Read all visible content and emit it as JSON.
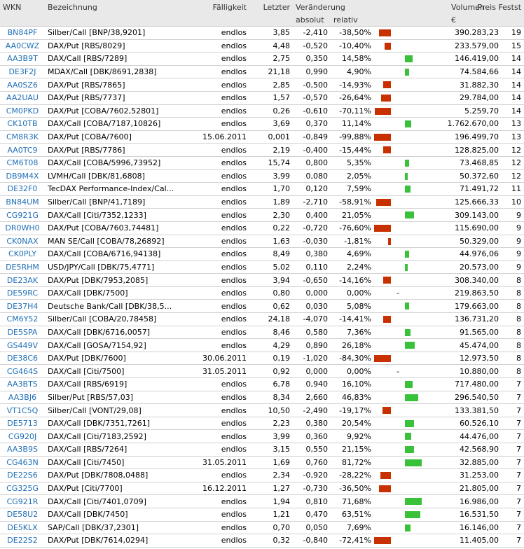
{
  "headers": {
    "wkn": "WKN",
    "bezeichnung": "Bezeichnung",
    "faelligkeit": "Fälligkeit",
    "letzter": "Letzter",
    "veraenderung": "Veränderung",
    "absolut": "absolut",
    "relativ": "relativ",
    "volumen": "Volumen",
    "waehrung": "€",
    "preis": "Preis Festst."
  },
  "colors": {
    "negative": "#c93000",
    "positive": "#39c239",
    "link": "#1f6eb6"
  },
  "rows": [
    {
      "wkn": "BN84PF",
      "name": "Silber/Call [BNP/38,9201]",
      "due": "endlos",
      "last": "3,85",
      "abs": "-2,410",
      "rel": "-38,50%",
      "relv": -38.5,
      "vol": "390.283,23",
      "fix": "19"
    },
    {
      "wkn": "AA0CWZ",
      "name": "DAX/Put [RBS/8029]",
      "due": "endlos",
      "last": "4,48",
      "abs": "-0,520",
      "rel": "-10,40%",
      "relv": -10.4,
      "vol": "233.579,00",
      "fix": "15"
    },
    {
      "wkn": "AA3B9T",
      "name": "DAX/Call [RBS/7289]",
      "due": "endlos",
      "last": "2,75",
      "abs": "0,350",
      "rel": "14,58%",
      "relv": 14.58,
      "vol": "146.419,00",
      "fix": "14"
    },
    {
      "wkn": "DE3F2J",
      "name": "MDAX/Call [DBK/8691,2838]",
      "due": "endlos",
      "last": "21,18",
      "abs": "0,990",
      "rel": "4,90%",
      "relv": 4.9,
      "vol": "74.584,66",
      "fix": "14"
    },
    {
      "wkn": "AA0SZ6",
      "name": "DAX/Put [RBS/7865]",
      "due": "endlos",
      "last": "2,85",
      "abs": "-0,500",
      "rel": "-14,93%",
      "relv": -14.93,
      "vol": "31.882,30",
      "fix": "14"
    },
    {
      "wkn": "AA2UAU",
      "name": "DAX/Put [RBS/7737]",
      "due": "endlos",
      "last": "1,57",
      "abs": "-0,570",
      "rel": "-26,64%",
      "relv": -26.64,
      "vol": "29.784,00",
      "fix": "14"
    },
    {
      "wkn": "CM0PKD",
      "name": "DAX/Put [COBA/7602,52801]",
      "due": "endlos",
      "last": "0,26",
      "abs": "-0,610",
      "rel": "-70,11%",
      "relv": -70.11,
      "vol": "5.259,70",
      "fix": "14"
    },
    {
      "wkn": "CK10TB",
      "name": "DAX/Call [COBA/7187,10826]",
      "due": "endlos",
      "last": "3,69",
      "abs": "0,370",
      "rel": "11,14%",
      "relv": 11.14,
      "vol": "1.762.670,00",
      "fix": "13"
    },
    {
      "wkn": "CM8R3K",
      "name": "DAX/Put [COBA/7600]",
      "due": "15.06.2011",
      "last": "0,001",
      "abs": "-0,849",
      "rel": "-99,88%",
      "relv": -99.88,
      "vol": "196.499,70",
      "fix": "13"
    },
    {
      "wkn": "AA0TC9",
      "name": "DAX/Put [RBS/7786]",
      "due": "endlos",
      "last": "2,19",
      "abs": "-0,400",
      "rel": "-15,44%",
      "relv": -15.44,
      "vol": "128.825,00",
      "fix": "12"
    },
    {
      "wkn": "CM6T08",
      "name": "DAX/Call [COBA/5996,73952]",
      "due": "endlos",
      "last": "15,74",
      "abs": "0,800",
      "rel": "5,35%",
      "relv": 5.35,
      "vol": "73.468,85",
      "fix": "12"
    },
    {
      "wkn": "DB9M4X",
      "name": "LVMH/Call [DBK/81,6808]",
      "due": "endlos",
      "last": "3,99",
      "abs": "0,080",
      "rel": "2,05%",
      "relv": 2.05,
      "vol": "50.372,60",
      "fix": "12"
    },
    {
      "wkn": "DE32F0",
      "name": "TecDAX Performance-Index/Cal...",
      "due": "endlos",
      "last": "1,70",
      "abs": "0,120",
      "rel": "7,59%",
      "relv": 7.59,
      "vol": "71.491,72",
      "fix": "11"
    },
    {
      "wkn": "BN84UM",
      "name": "Silber/Call [BNP/41,7189]",
      "due": "endlos",
      "last": "1,89",
      "abs": "-2,710",
      "rel": "-58,91%",
      "relv": -58.91,
      "vol": "125.666,33",
      "fix": "10"
    },
    {
      "wkn": "CG921G",
      "name": "DAX/Call [Citi/7352,1233]",
      "due": "endlos",
      "last": "2,30",
      "abs": "0,400",
      "rel": "21,05%",
      "relv": 21.05,
      "vol": "309.143,00",
      "fix": "9"
    },
    {
      "wkn": "DR0WH0",
      "name": "DAX/Put [COBA/7603,74481]",
      "due": "endlos",
      "last": "0,22",
      "abs": "-0,720",
      "rel": "-76,60%",
      "relv": -76.6,
      "vol": "115.690,00",
      "fix": "9"
    },
    {
      "wkn": "CK0NAX",
      "name": "MAN SE/Call [COBA/78,26892]",
      "due": "endlos",
      "last": "1,63",
      "abs": "-0,030",
      "rel": "-1,81%",
      "relv": -1.81,
      "vol": "50.329,00",
      "fix": "9"
    },
    {
      "wkn": "CK0PLY",
      "name": "DAX/Call [COBA/6716,94138]",
      "due": "endlos",
      "last": "8,49",
      "abs": "0,380",
      "rel": "4,69%",
      "relv": 4.69,
      "vol": "44.976,06",
      "fix": "9"
    },
    {
      "wkn": "DE5RHM",
      "name": "USD/JPY/Call [DBK/75,4771]",
      "due": "endlos",
      "last": "5,02",
      "abs": "0,110",
      "rel": "2,24%",
      "relv": 2.24,
      "vol": "20.573,00",
      "fix": "9"
    },
    {
      "wkn": "DE23AK",
      "name": "DAX/Put [DBK/7953,2085]",
      "due": "endlos",
      "last": "3,94",
      "abs": "-0,650",
      "rel": "-14,16%",
      "relv": -14.16,
      "vol": "308.340,00",
      "fix": "8"
    },
    {
      "wkn": "DE59RC",
      "name": "DAX/Call [DBK/7500]",
      "due": "endlos",
      "last": "0,80",
      "abs": "0,000",
      "rel": "0,00%",
      "relv": 0,
      "vol": "219.863,50",
      "fix": "8"
    },
    {
      "wkn": "DE37H4",
      "name": "Deutsche Bank/Call [DBK/38,5...",
      "due": "endlos",
      "last": "0,62",
      "abs": "0,030",
      "rel": "5,08%",
      "relv": 5.08,
      "vol": "179.663,00",
      "fix": "8"
    },
    {
      "wkn": "CM6Y52",
      "name": "Silber/Call [COBA/20,78458]",
      "due": "endlos",
      "last": "24,18",
      "abs": "-4,070",
      "rel": "-14,41%",
      "relv": -14.41,
      "vol": "136.731,20",
      "fix": "8"
    },
    {
      "wkn": "DE5SPA",
      "name": "DAX/Call [DBK/6716,0057]",
      "due": "endlos",
      "last": "8,46",
      "abs": "0,580",
      "rel": "7,36%",
      "relv": 7.36,
      "vol": "91.565,00",
      "fix": "8"
    },
    {
      "wkn": "GS449V",
      "name": "DAX/Call [GOSA/7154,92]",
      "due": "endlos",
      "last": "4,29",
      "abs": "0,890",
      "rel": "26,18%",
      "relv": 26.18,
      "vol": "45.474,00",
      "fix": "8"
    },
    {
      "wkn": "DE38C6",
      "name": "DAX/Put [DBK/7600]",
      "due": "30.06.2011",
      "last": "0,19",
      "abs": "-1,020",
      "rel": "-84,30%",
      "relv": -84.3,
      "vol": "12.973,50",
      "fix": "8"
    },
    {
      "wkn": "CG464S",
      "name": "DAX/Call [Citi/7500]",
      "due": "31.05.2011",
      "last": "0,92",
      "abs": "0,000",
      "rel": "0,00%",
      "relv": 0,
      "vol": "10.880,00",
      "fix": "8"
    },
    {
      "wkn": "AA3BTS",
      "name": "DAX/Call [RBS/6919]",
      "due": "endlos",
      "last": "6,78",
      "abs": "0,940",
      "rel": "16,10%",
      "relv": 16.1,
      "vol": "717.480,00",
      "fix": "7"
    },
    {
      "wkn": "AA3BJ6",
      "name": "Silber/Put [RBS/57,03]",
      "due": "endlos",
      "last": "8,34",
      "abs": "2,660",
      "rel": "46,83%",
      "relv": 46.83,
      "vol": "296.540,50",
      "fix": "7"
    },
    {
      "wkn": "VT1C5Q",
      "name": "Silber/Call [VONT/29,08]",
      "due": "endlos",
      "last": "10,50",
      "abs": "-2,490",
      "rel": "-19,17%",
      "relv": -19.17,
      "vol": "133.381,50",
      "fix": "7"
    },
    {
      "wkn": "DE5713",
      "name": "DAX/Call [DBK/7351,7261]",
      "due": "endlos",
      "last": "2,23",
      "abs": "0,380",
      "rel": "20,54%",
      "relv": 20.54,
      "vol": "60.526,10",
      "fix": "7"
    },
    {
      "wkn": "CG920J",
      "name": "DAX/Call [Citi/7183,2592]",
      "due": "endlos",
      "last": "3,99",
      "abs": "0,360",
      "rel": "9,92%",
      "relv": 9.92,
      "vol": "44.476,00",
      "fix": "7"
    },
    {
      "wkn": "AA3B9S",
      "name": "DAX/Call [RBS/7264]",
      "due": "endlos",
      "last": "3,15",
      "abs": "0,550",
      "rel": "21,15%",
      "relv": 21.15,
      "vol": "42.568,90",
      "fix": "7"
    },
    {
      "wkn": "CG463N",
      "name": "DAX/Call [Citi/7450]",
      "due": "31.05.2011",
      "last": "1,69",
      "abs": "0,760",
      "rel": "81,72%",
      "relv": 81.72,
      "vol": "32.885,00",
      "fix": "7"
    },
    {
      "wkn": "DE22S6",
      "name": "DAX/Put [DBK/7808,0488]",
      "due": "endlos",
      "last": "2,34",
      "abs": "-0,920",
      "rel": "-28,22%",
      "relv": -28.22,
      "vol": "31.253,00",
      "fix": "7"
    },
    {
      "wkn": "CG325G",
      "name": "DAX/Put [Citi/7700]",
      "due": "16.12.2011",
      "last": "1,27",
      "abs": "-0,730",
      "rel": "-36,50%",
      "relv": -36.5,
      "vol": "21.805,00",
      "fix": "7"
    },
    {
      "wkn": "CG921R",
      "name": "DAX/Call [Citi/7401,0709]",
      "due": "endlos",
      "last": "1,94",
      "abs": "0,810",
      "rel": "71,68%",
      "relv": 71.68,
      "vol": "16.986,00",
      "fix": "7"
    },
    {
      "wkn": "DE58U2",
      "name": "DAX/Call [DBK/7450]",
      "due": "endlos",
      "last": "1,21",
      "abs": "0,470",
      "rel": "63,51%",
      "relv": 63.51,
      "vol": "16.531,50",
      "fix": "7"
    },
    {
      "wkn": "DE5KLX",
      "name": "SAP/Call [DBK/37,2301]",
      "due": "endlos",
      "last": "0,70",
      "abs": "0,050",
      "rel": "7,69%",
      "relv": 7.69,
      "vol": "16.146,00",
      "fix": "7"
    },
    {
      "wkn": "DE22S2",
      "name": "DAX/Put [DBK/7614,0294]",
      "due": "endlos",
      "last": "0,32",
      "abs": "-0,840",
      "rel": "-72,41%",
      "relv": -72.41,
      "vol": "11.405,00",
      "fix": "7"
    }
  ]
}
